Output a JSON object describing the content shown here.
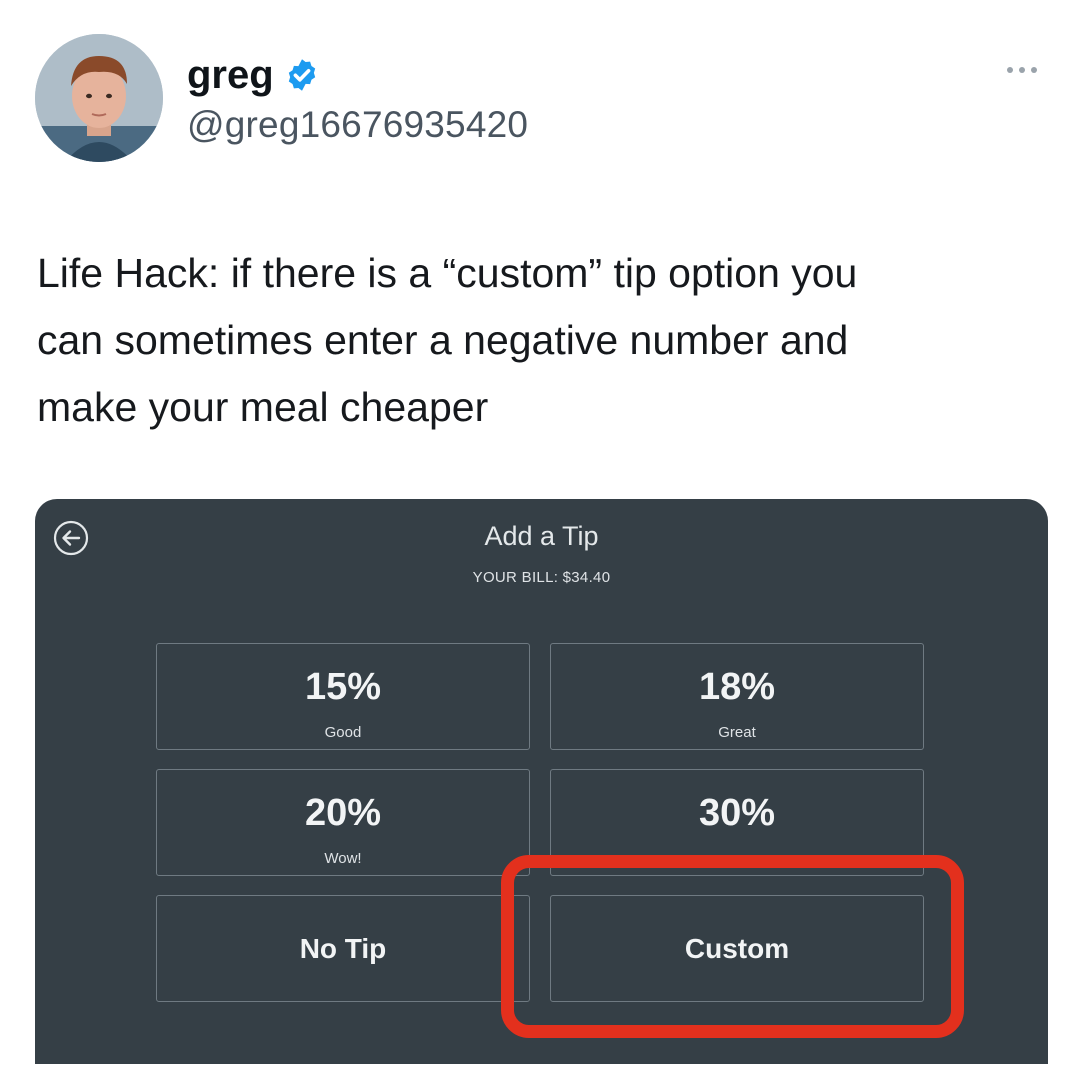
{
  "tweet": {
    "author_name": "greg",
    "handle": "@greg16676935420",
    "text": "Life Hack: if there is a “custom” tip option you\ncan sometimes enter a negative number and\nmake your meal cheaper",
    "icons": {
      "verified": "verified-badge-icon",
      "more": "more-options-icon"
    },
    "colors": {
      "verified": "#1d9bf0",
      "highlight": "#e3301d"
    }
  },
  "tip_screen": {
    "title": "Add a Tip",
    "bill_text": "YOUR BILL: $34.40",
    "back_icon": "back-arrow-icon",
    "background": "#353f46",
    "options": [
      {
        "percent": "15%",
        "label": "Good"
      },
      {
        "percent": "18%",
        "label": "Great"
      },
      {
        "percent": "20%",
        "label": "Wow!"
      },
      {
        "percent": "30%",
        "label": ""
      }
    ],
    "no_tip_label": "No Tip",
    "custom_label": "Custom"
  }
}
